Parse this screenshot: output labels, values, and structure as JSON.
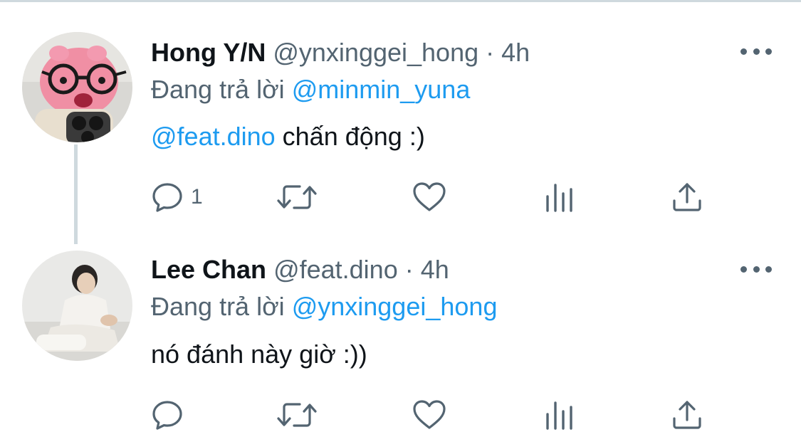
{
  "tweets": [
    {
      "author_name": "Hong Y/N",
      "handle": "@ynxinggei_hong",
      "separator": "·",
      "time": "4h",
      "reply_prefix": "Đang trả lời",
      "reply_to": "@minmin_yuna",
      "body_mention": "@feat.dino",
      "body_text": " chấn động :)",
      "reply_count": "1",
      "avatar_icon": "pink-plush-with-glasses-photo"
    },
    {
      "author_name": "Lee Chan",
      "handle": "@feat.dino",
      "separator": "·",
      "time": "4h",
      "reply_prefix": "Đang trả lời",
      "reply_to": "@ynxinggei_hong",
      "body_mention": "",
      "body_text": "nó đánh này giờ :))",
      "reply_count": "",
      "avatar_icon": "person-sitting-photo"
    }
  ],
  "colors": {
    "text": "#0f1419",
    "secondary": "#536471",
    "mention": "#1d9bf0",
    "divider": "#cfd9de"
  },
  "icons": [
    "reply-icon",
    "retweet-icon",
    "like-icon",
    "views-icon",
    "share-icon",
    "more-icon"
  ]
}
